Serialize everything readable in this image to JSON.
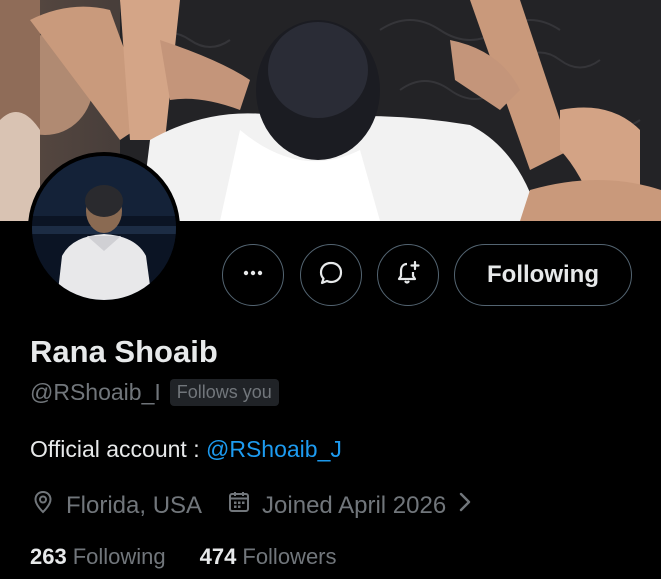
{
  "profile": {
    "display_name": "Rana Shoaib",
    "handle": "@RShoaib_I",
    "follows_you_badge": "Follows you",
    "bio_prefix": "Official account : ",
    "bio_link": "@RShoaib_J",
    "location": "Florida, USA",
    "joined": "Joined April 2026",
    "following_count": "263",
    "following_label": "Following",
    "followers_count": "474",
    "followers_label": "Followers"
  },
  "actions": {
    "more_icon": "more-horizontal-icon",
    "message_icon": "message-bubble-icon",
    "notify_icon": "bell-plus-icon",
    "follow_button_label": "Following"
  },
  "icons": {
    "location": "location-pin-icon",
    "joined": "calendar-icon",
    "chevron": "chevron-right-icon"
  },
  "colors": {
    "background": "#000000",
    "text_primary": "#e7e9ea",
    "text_secondary": "#71767b",
    "link": "#1d9bf0",
    "border": "#536471"
  }
}
